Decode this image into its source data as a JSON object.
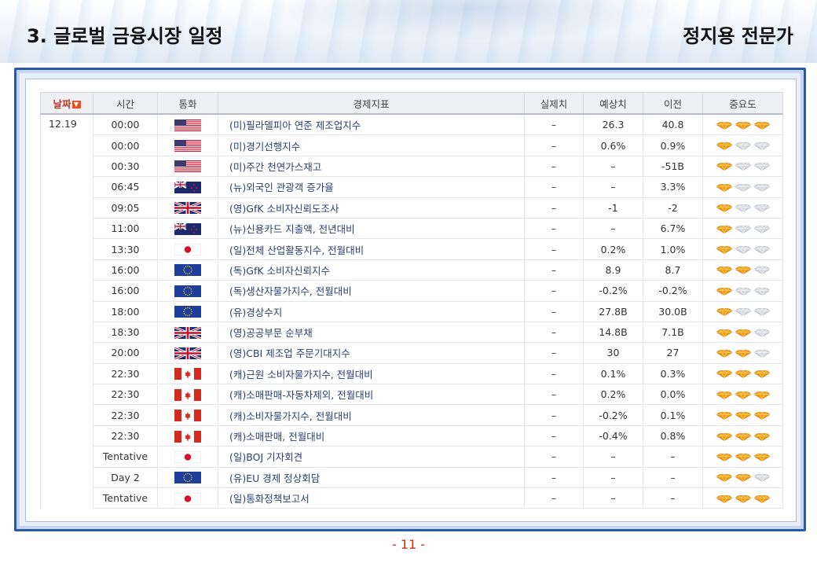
{
  "header": {
    "title": "3. 글로벌 금융시장 일정",
    "presenter": "정지용 전문가"
  },
  "table": {
    "columns": {
      "date": "날짜",
      "time": "시간",
      "currency": "통화",
      "indicator": "경제지표",
      "actual": "실제치",
      "forecast": "예상치",
      "previous": "이전",
      "importance": "중요도"
    },
    "date_value": "12.19",
    "rows": [
      {
        "time": "00:00",
        "flag": "us",
        "indicator": "(미)필라델피아 연준 제조업지수",
        "actual": "–",
        "forecast": "26.3",
        "previous": "40.8",
        "importance": 3
      },
      {
        "time": "00:00",
        "flag": "us",
        "indicator": "(미)경기선행지수",
        "actual": "–",
        "forecast": "0.6%",
        "previous": "0.9%",
        "importance": 1
      },
      {
        "time": "00:30",
        "flag": "us",
        "indicator": "(미)주간 천연가스재고",
        "actual": "–",
        "forecast": "–",
        "previous": "-51B",
        "importance": 1
      },
      {
        "time": "06:45",
        "flag": "nz",
        "indicator": "(뉴)외국인 관광객 증가율",
        "actual": "–",
        "forecast": "–",
        "previous": "3.3%",
        "importance": 1
      },
      {
        "time": "09:05",
        "flag": "uk",
        "indicator": "(영)GfK 소비자신뢰도조사",
        "actual": "–",
        "forecast": "-1",
        "previous": "-2",
        "importance": 1
      },
      {
        "time": "11:00",
        "flag": "nz",
        "indicator": "(뉴)신용카드 지출액, 전년대비",
        "actual": "–",
        "forecast": "–",
        "previous": "6.7%",
        "importance": 1
      },
      {
        "time": "13:30",
        "flag": "jp",
        "indicator": "(일)전체 산업활동지수, 전월대비",
        "actual": "–",
        "forecast": "0.2%",
        "previous": "1.0%",
        "importance": 1
      },
      {
        "time": "16:00",
        "flag": "eu",
        "indicator": "(독)GfK 소비자신뢰지수",
        "actual": "–",
        "forecast": "8.9",
        "previous": "8.7",
        "importance": 2
      },
      {
        "time": "16:00",
        "flag": "eu",
        "indicator": "(독)생산자물가지수, 전월대비",
        "actual": "–",
        "forecast": "-0.2%",
        "previous": "-0.2%",
        "importance": 1
      },
      {
        "time": "18:00",
        "flag": "eu",
        "indicator": "(유)경상수지",
        "actual": "–",
        "forecast": "27.8B",
        "previous": "30.0B",
        "importance": 1
      },
      {
        "time": "18:30",
        "flag": "uk",
        "indicator": "(영)공공부문 순부채",
        "actual": "–",
        "forecast": "14.8B",
        "previous": "7.1B",
        "importance": 2
      },
      {
        "time": "20:00",
        "flag": "uk",
        "indicator": "(영)CBI 제조업 주문기대지수",
        "actual": "–",
        "forecast": "30",
        "previous": "27",
        "importance": 2
      },
      {
        "time": "22:30",
        "flag": "ca",
        "indicator": "(캐)근원 소비자물가지수, 전월대비",
        "actual": "–",
        "forecast": "0.1%",
        "previous": "0.3%",
        "importance": 3
      },
      {
        "time": "22:30",
        "flag": "ca",
        "indicator": "(캐)소매판매-자동차제외, 전월대비",
        "actual": "–",
        "forecast": "0.2%",
        "previous": "0.0%",
        "importance": 3
      },
      {
        "time": "22:30",
        "flag": "ca",
        "indicator": "(캐)소비자물가지수, 전월대비",
        "actual": "–",
        "forecast": "-0.2%",
        "previous": "0.1%",
        "importance": 3
      },
      {
        "time": "22:30",
        "flag": "ca",
        "indicator": "(캐)소매판매, 전월대비",
        "actual": "–",
        "forecast": "-0.4%",
        "previous": "0.8%",
        "importance": 3
      },
      {
        "time": "Tentative",
        "flag": "jp",
        "indicator": "(일)BOJ 기자회견",
        "actual": "–",
        "forecast": "–",
        "previous": "–",
        "importance": 3
      },
      {
        "time": "Day 2",
        "flag": "eu",
        "indicator": "(유)EU 경제 정상회담",
        "actual": "–",
        "forecast": "–",
        "previous": "–",
        "importance": 2
      },
      {
        "time": "Tentative",
        "flag": "jp",
        "indicator": "(일)통화정책보고서",
        "actual": "–",
        "forecast": "–",
        "previous": "–",
        "importance": 3
      }
    ]
  },
  "colors": {
    "accent_blue": "#2c5aa0",
    "gem_active": "#f39c12",
    "gem_inactive": "#d5d8dc",
    "page_number": "#d12a1a"
  },
  "icons": {
    "sort": "sort-down-icon",
    "importance": "diamond-icon"
  },
  "footer": {
    "page_number": "- 11 -"
  }
}
